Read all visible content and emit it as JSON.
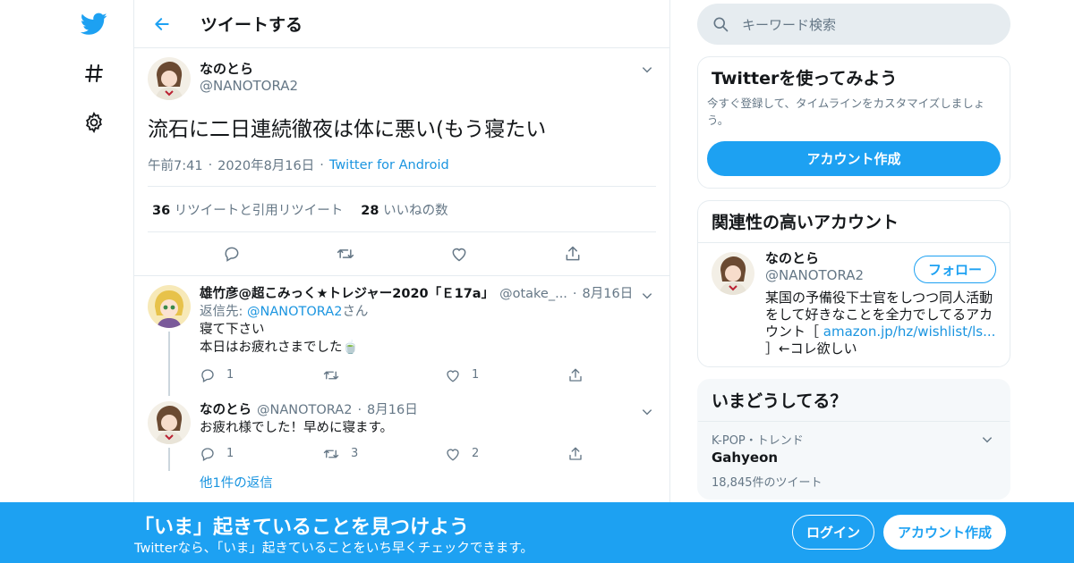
{
  "colors": {
    "accent": "#1da1f2",
    "link": "#1b95e0",
    "muted": "#657786",
    "border": "#e6ecf0"
  },
  "nav": {
    "icons": [
      "twitter-bird-icon",
      "hashtag-icon",
      "gear-icon"
    ]
  },
  "header": {
    "title": "ツイートする"
  },
  "tweet": {
    "name": "なのとら",
    "handle": "@NANOTORA2",
    "text": "流石に二日連続徹夜は体に悪い(もう寝たい",
    "time": "午前7:41",
    "date": "2020年8月16日",
    "source": "Twitter for Android",
    "retweets_count": "36",
    "retweets_label": "リツイートと引用リツイート",
    "likes_count": "28",
    "likes_label": "いいねの数"
  },
  "replies": [
    {
      "name": "雄竹彦@超こみっく★トレジャー2020「Ｅ17a」",
      "handle": "@otake_...",
      "date": "8月16日",
      "reply_to_label": "返信先:",
      "reply_to_handle": "@NANOTORA2",
      "reply_to_suffix": "さん",
      "line1": "寝て下さい",
      "line2": "本日はお疲れさまでした🍵",
      "replies": "1",
      "retweets": "",
      "likes": "1"
    },
    {
      "name": "なのとら",
      "handle": "@NANOTORA2",
      "date": "8月16日",
      "line1": "お疲れ様でした！早めに寝ます。",
      "replies": "1",
      "retweets": "3",
      "likes": "2",
      "more_replies": "他1件の返信"
    }
  ],
  "search": {
    "placeholder": "キーワード検索"
  },
  "signup_card": {
    "title": "Twitterを使ってみよう",
    "subtitle": "今すぐ登録して、タイムラインをカスタマイズしましょう。",
    "button": "アカウント作成"
  },
  "related": {
    "title": "関連性の高いアカウント",
    "name": "なのとら",
    "handle": "@NANOTORA2",
    "follow": "フォロー",
    "bio_pre": "某国の予備役下士官をしつつ同人活動をして好きなことを全力でしてるアカウント［",
    "bio_link": "amazon.jp/hz/wishlist/ls...",
    "bio_post": "］←コレ欲しい"
  },
  "trends": {
    "title": "いまどうしてる？",
    "item": {
      "context": "K-POP・トレンド",
      "name": "Gahyeon",
      "count": "18,845件のツイート"
    }
  },
  "banner": {
    "title": "「いま」起きていることを見つけよう",
    "subtitle": "Twitterなら、「いま」起きていることをいち早くチェックできます。",
    "login": "ログイン",
    "signup": "アカウント作成"
  }
}
